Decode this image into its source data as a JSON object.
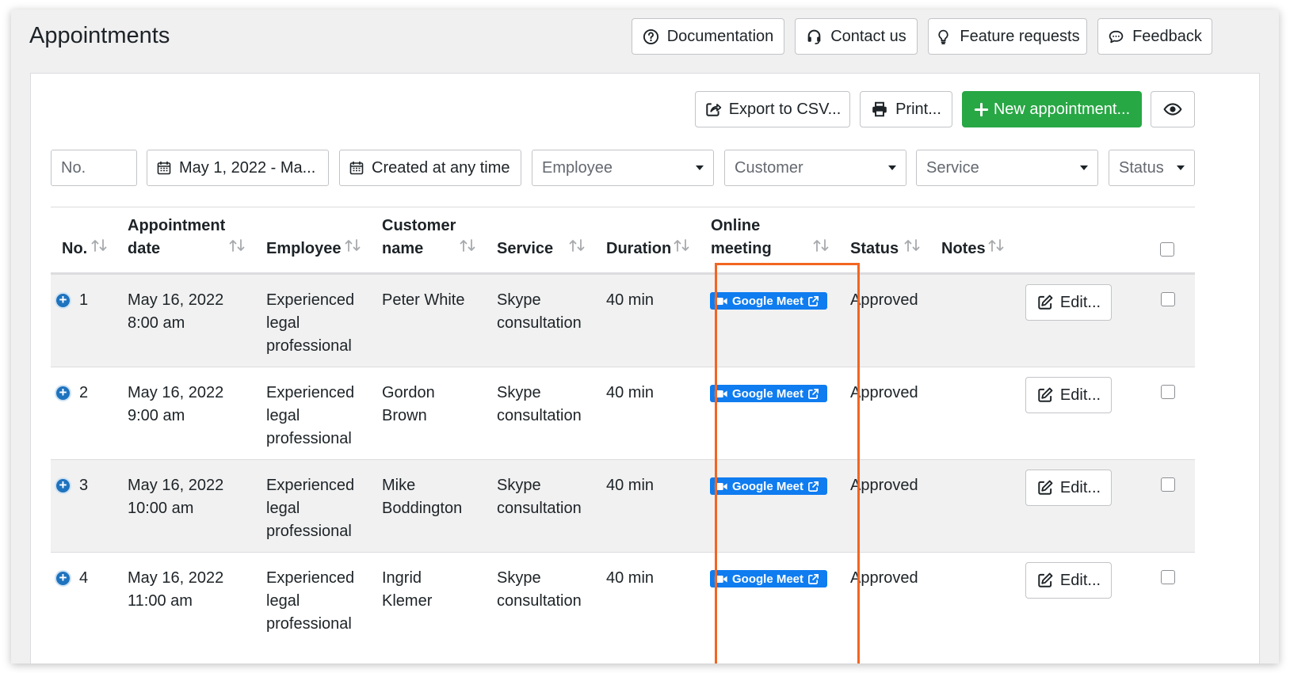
{
  "header": {
    "title": "Appointments",
    "buttons": {
      "documentation": "Documentation",
      "contact": "Contact us",
      "feature": "Feature requests",
      "feedback": "Feedback"
    }
  },
  "toolbar": {
    "export": "Export to CSV...",
    "print": "Print...",
    "new": "New appointment..."
  },
  "filters": {
    "no_placeholder": "No.",
    "date_range": "May 1, 2022 - Ma...",
    "created": "Created at any time",
    "employee": "Employee",
    "customer": "Customer",
    "service": "Service",
    "status": "Status"
  },
  "columns": {
    "no": "No.",
    "date_l1": "Appointment",
    "date_l2": "date",
    "employee": "Employee",
    "customer_l1": "Customer",
    "customer_l2": "name",
    "service": "Service",
    "duration": "Duration",
    "online_l1": "Online",
    "online_l2": "meeting",
    "status": "Status",
    "notes": "Notes"
  },
  "rows": [
    {
      "no": "1",
      "date": "May 16, 2022",
      "time": "8:00 am",
      "emp1": "Experienced",
      "emp2": "legal",
      "emp3": "professional",
      "cust1": "Peter White",
      "cust2": "",
      "svc1": "Skype",
      "svc2": "consultation",
      "duration": "40 min",
      "meeting": "Google Meet",
      "status": "Approved",
      "edit": "Edit..."
    },
    {
      "no": "2",
      "date": "May 16, 2022",
      "time": "9:00 am",
      "emp1": "Experienced",
      "emp2": "legal",
      "emp3": "professional",
      "cust1": "Gordon",
      "cust2": "Brown",
      "svc1": "Skype",
      "svc2": "consultation",
      "duration": "40 min",
      "meeting": "Google Meet",
      "status": "Approved",
      "edit": "Edit..."
    },
    {
      "no": "3",
      "date": "May 16, 2022",
      "time": "10:00 am",
      "emp1": "Experienced",
      "emp2": "legal",
      "emp3": "professional",
      "cust1": "Mike",
      "cust2": "Boddington",
      "svc1": "Skype",
      "svc2": "consultation",
      "duration": "40 min",
      "meeting": "Google Meet",
      "status": "Approved",
      "edit": "Edit..."
    },
    {
      "no": "4",
      "date": "May 16, 2022",
      "time": "11:00 am",
      "emp1": "Experienced",
      "emp2": "legal",
      "emp3": "professional",
      "cust1": "Ingrid",
      "cust2": "Klemer",
      "svc1": "Skype",
      "svc2": "consultation",
      "duration": "40 min",
      "meeting": "Google Meet",
      "status": "Approved",
      "edit": "Edit..."
    }
  ],
  "colors": {
    "new_button": "#28a745",
    "meet_badge": "#0f7cf0",
    "highlight": "#f26522",
    "expand_icon": "#1e73be"
  }
}
